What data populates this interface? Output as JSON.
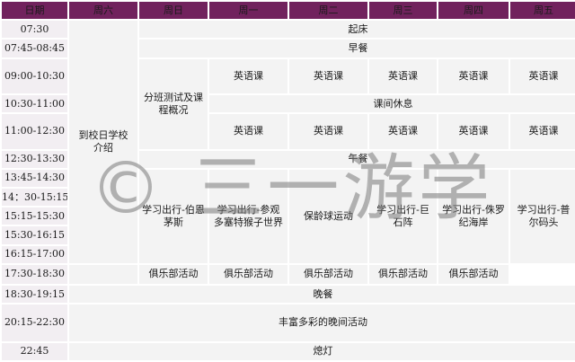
{
  "header": [
    "日期",
    "周六",
    "周日",
    "周一",
    "周二",
    "周三",
    "周四",
    "周五"
  ],
  "times": [
    "07:30",
    "07:45-08:45",
    "09:00-10:30",
    "10:30-11:00",
    "11:00-12:30",
    "12:30-13:30",
    "13:45-14:30",
    "14：30-15:15",
    "15:15-15:30",
    "15:30-16:15",
    "16:15-17:00",
    "17:30-18:30",
    "18:30-19:15",
    "20:15-22:30",
    "22:45"
  ],
  "saturday": "到校日学校介绍",
  "sunday_morning": "分班测试及课程概况",
  "sunday_afternoon": "学习出行-伯恩茅斯",
  "wake_up": "起床",
  "breakfast": "早餐",
  "english_class": "英语课",
  "break": "课间休息",
  "lunch": "午餐",
  "outings": [
    "学习出行-参观多塞特猴子世界",
    "保龄球运动",
    "学习出行-巨石阵",
    "学习出行-侏罗纪海岸",
    "学习出行-普尔码头"
  ],
  "club": "俱乐部活动",
  "dinner": "晚餐",
  "evening": "丰富多彩的晚间活动",
  "lights_out": "熄灯",
  "watermark": "© 三一游学"
}
